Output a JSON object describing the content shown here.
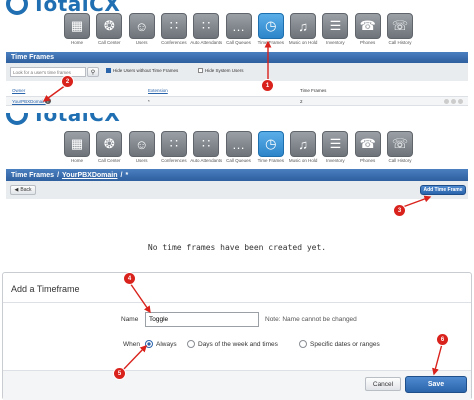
{
  "logo": {
    "text": "TotalCX"
  },
  "toolbar": {
    "items": [
      {
        "label": "Home",
        "icon": "grid-icon"
      },
      {
        "label": "Call Center",
        "icon": "headset-icon"
      },
      {
        "label": "Users",
        "icon": "smiley-icon"
      },
      {
        "label": "Conferences",
        "icon": "conference-icon"
      },
      {
        "label": "Auto Attendants",
        "icon": "keypad-icon"
      },
      {
        "label": "Call Queues",
        "icon": "queue-icon"
      },
      {
        "label": "Time Frames",
        "icon": "clock-icon"
      },
      {
        "label": "Music on Hold",
        "icon": "music-icon"
      },
      {
        "label": "Inventory",
        "icon": "list-icon"
      },
      {
        "label": "Phones",
        "icon": "phone-icon"
      },
      {
        "label": "Call History",
        "icon": "call-history-icon"
      }
    ],
    "active": "Time Frames"
  },
  "panel1": {
    "title": "Time Frames",
    "search_placeholder": "Look for a user's time frames",
    "hide_users_label": "Hide Users without Time Frames",
    "hide_system_label": "Hide System Users",
    "columns": [
      "Owner",
      "Extension",
      "Time Frames"
    ],
    "row": {
      "owner": "YourPBXDomain",
      "extension": "*",
      "time_frames": "2"
    }
  },
  "panel2": {
    "breadcrumb_root": "Time Frames",
    "breadcrumb_sep1": "/",
    "breadcrumb_domain": "YourPBXDomain",
    "breadcrumb_sep2": "/",
    "breadcrumb_tail": "*",
    "back_label": "Back",
    "add_label": "Add Time Frame",
    "empty_message": "No time frames have been created yet."
  },
  "dialog": {
    "title": "Add a Timeframe",
    "name_label": "Name",
    "name_value": "Toggle",
    "name_note": "Note: Name cannot be changed",
    "when_label": "When",
    "options": [
      "Always",
      "Days of the week and times",
      "Specific dates or ranges"
    ],
    "selected": "Always",
    "cancel_label": "Cancel",
    "save_label": "Save"
  },
  "callouts": [
    "1",
    "2",
    "3",
    "4",
    "5",
    "6"
  ],
  "colors": {
    "accent": "#2e5f9e",
    "callout": "#d9221c",
    "active_tile": "#2d85c9"
  }
}
